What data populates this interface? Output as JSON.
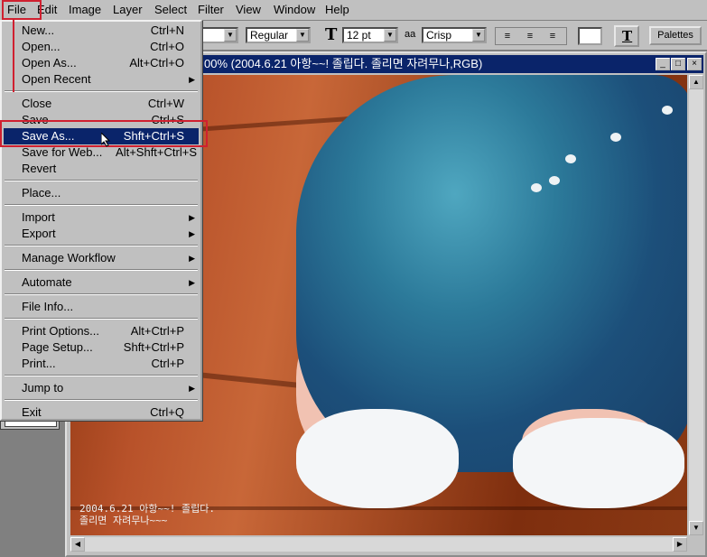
{
  "menubar": {
    "file": "File",
    "edit": "Edit",
    "image": "Image",
    "layer": "Layer",
    "select": "Select",
    "filter": "Filter",
    "view": "View",
    "window": "Window",
    "help": "Help"
  },
  "options": {
    "font_style": "Regular",
    "font_size": "12 pt",
    "aa_icon": "aa",
    "antialias": "Crisp",
    "palettes": "Palettes"
  },
  "document": {
    "title": "00% (2004.6.21 아항~~! 졸립다.  졸리면 자려무나,RGB)",
    "caption_line1": "2004.6.21 아항~~! 졸립다.",
    "caption_line2": "졸리면 자려무나~~~"
  },
  "file_menu": {
    "items": [
      {
        "label": "New...",
        "shortcut": "Ctrl+N"
      },
      {
        "label": "Open...",
        "shortcut": "Ctrl+O"
      },
      {
        "label": "Open As...",
        "shortcut": "Alt+Ctrl+O"
      },
      {
        "label": "Open Recent",
        "shortcut": ""
      },
      {
        "label": "Close",
        "shortcut": "Ctrl+W"
      },
      {
        "label": "Save",
        "shortcut": "Ctrl+S"
      },
      {
        "label": "Save As...",
        "shortcut": "Shft+Ctrl+S"
      },
      {
        "label": "Save for Web...",
        "shortcut": "Alt+Shft+Ctrl+S"
      },
      {
        "label": "Revert",
        "shortcut": ""
      },
      {
        "label": "Place...",
        "shortcut": ""
      },
      {
        "label": "Import",
        "shortcut": ""
      },
      {
        "label": "Export",
        "shortcut": ""
      },
      {
        "label": "Manage Workflow",
        "shortcut": ""
      },
      {
        "label": "Automate",
        "shortcut": ""
      },
      {
        "label": "File Info...",
        "shortcut": ""
      },
      {
        "label": "Print Options...",
        "shortcut": "Alt+Ctrl+P"
      },
      {
        "label": "Page Setup...",
        "shortcut": "Shft+Ctrl+P"
      },
      {
        "label": "Print...",
        "shortcut": "Ctrl+P"
      },
      {
        "label": "Jump to",
        "shortcut": ""
      },
      {
        "label": "Exit",
        "shortcut": "Ctrl+Q"
      }
    ]
  },
  "colors": {
    "accent_highlight": "#d02030",
    "selection": "#0a246a",
    "chrome": "#c0c0c0"
  }
}
